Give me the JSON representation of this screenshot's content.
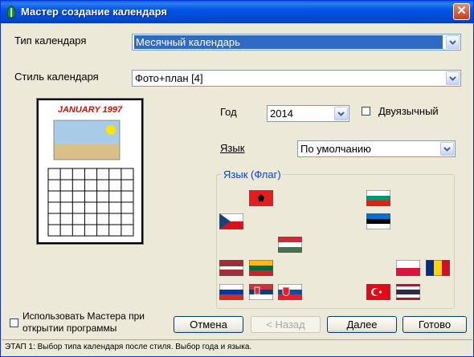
{
  "window": {
    "title": "Мастер создание календаря"
  },
  "calendar_type": {
    "label": "Тип календаря",
    "value": "Месячный календарь"
  },
  "calendar_style": {
    "label": "Стиль календаря",
    "value": "Фото+план [4]"
  },
  "preview": {
    "heading": "JANUARY 1997"
  },
  "year": {
    "label": "Год",
    "value": "2014"
  },
  "bilingual": {
    "label": "Двуязычный",
    "checked": false
  },
  "language": {
    "label": "Язык",
    "value": "По умолчанию"
  },
  "flag_group": {
    "legend": "Язык (Флаг)",
    "flags": [
      {
        "id": "al",
        "icon": "albania-flag-icon"
      },
      {
        "id": "bg",
        "icon": "bulgaria-flag-icon"
      },
      {
        "id": "cz",
        "icon": "czech-flag-icon"
      },
      {
        "id": "ee",
        "icon": "estonia-flag-icon"
      },
      {
        "id": "hu",
        "icon": "hungary-flag-icon"
      },
      {
        "id": "lv",
        "icon": "latvia-flag-icon"
      },
      {
        "id": "lt",
        "icon": "lithuania-flag-icon"
      },
      {
        "id": "pl",
        "icon": "poland-flag-icon"
      },
      {
        "id": "ro",
        "icon": "romania-flag-icon"
      },
      {
        "id": "ru",
        "icon": "russia-flag-icon"
      },
      {
        "id": "rs",
        "icon": "serbia-flag-icon"
      },
      {
        "id": "sk",
        "icon": "slovakia-flag-icon"
      },
      {
        "id": "tr",
        "icon": "turkey-flag-icon"
      },
      {
        "id": "th",
        "icon": "thailand-flag-icon"
      }
    ]
  },
  "use_wizard": {
    "label_line1": "Использовать Мастера при",
    "label_line2": "открытии программы",
    "checked": false
  },
  "buttons": {
    "cancel": "Отмена",
    "back": "< Назад",
    "next": "Далее",
    "finish": "Готово"
  },
  "status": "ЭТАП 1: Выбор типа календаря после стиля. Выбор года и языка.",
  "colors": {
    "title_bar": "#0055e5",
    "selection": "#316ac5",
    "legend": "#0046d5",
    "dialog_bg": "#ece9d8"
  }
}
